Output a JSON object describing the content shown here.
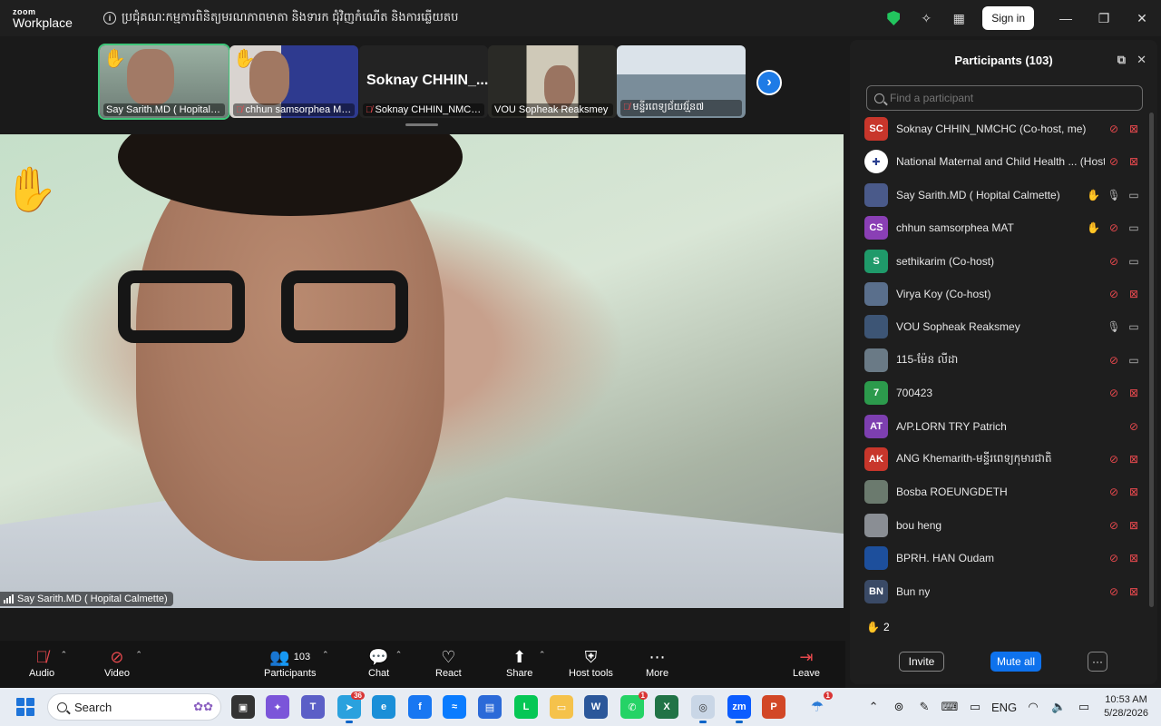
{
  "window": {
    "logo_line1": "zoom",
    "logo_line2": "Workplace",
    "meeting_title": "ប្រជុំគណៈកម្មការពិនិត្យមរណភាពមាតា និងទារក ជុំវិញកំណើត និងការឆ្លើយតប",
    "sign_in": "Sign in"
  },
  "thumbnails": [
    {
      "name": "Say Sarith.MD ( Hopital Cal...",
      "hand": true,
      "muted": false,
      "active": true,
      "bg": "#7e8b86"
    },
    {
      "name": "chhun samsorphea MAT",
      "hand": true,
      "muted": true,
      "active": false,
      "bg": "#3b3f8f"
    },
    {
      "name": "Soknay CHHIN_NMCHC",
      "hand": false,
      "muted": true,
      "active": false,
      "bg": "#2b2b2b",
      "big": "Soknay  CHHIN_..."
    },
    {
      "name": "VOU Sopheak Reaksmey",
      "hand": false,
      "muted": false,
      "active": false,
      "bg": "#3a3a34"
    },
    {
      "name": "មន្ទីរពេទ្យជ័យវរ្ម័ន៧",
      "hand": false,
      "muted": true,
      "active": false,
      "bg": "#5d6c7a"
    }
  ],
  "main": {
    "speaker": "Say Sarith.MD ( Hopital Calmette)"
  },
  "toolbar": {
    "audio": "Audio",
    "video": "Video",
    "participants": "Participants",
    "participants_count": "103",
    "chat": "Chat",
    "react": "React",
    "share": "Share",
    "host_tools": "Host tools",
    "more": "More",
    "leave": "Leave"
  },
  "panel": {
    "title": "Participants (103)",
    "search_placeholder": "Find a participant",
    "raised_hands": "2",
    "invite": "Invite",
    "mute_all": "Mute all",
    "more": "···",
    "participants": [
      {
        "name": "Soknay CHHIN_NMCHC (Co-host, me)",
        "initials": "SC",
        "color": "#c8362b",
        "hand": false,
        "mic": "off",
        "cam": "off"
      },
      {
        "name": "National Maternal and Child Health ... (Host)",
        "initials": "",
        "color": "#ffffff",
        "hand": false,
        "mic": "off",
        "cam": "off"
      },
      {
        "name": "Say Sarith.MD ( Hopital Calmette)",
        "initials": "",
        "color": "#4a5a8a",
        "hand": true,
        "mic": "on",
        "cam": "on"
      },
      {
        "name": "chhun samsorphea MAT",
        "initials": "CS",
        "color": "#8a3fb5",
        "hand": true,
        "mic": "off",
        "cam": "on"
      },
      {
        "name": "sethikarim (Co-host)",
        "initials": "S",
        "color": "#1f9a6a",
        "hand": false,
        "mic": "off",
        "cam": "on"
      },
      {
        "name": "Virya Koy (Co-host)",
        "initials": "",
        "color": "#5a6f8c",
        "hand": false,
        "mic": "off",
        "cam": "off"
      },
      {
        "name": "VOU Sopheak Reaksmey",
        "initials": "",
        "color": "#3d5575",
        "hand": false,
        "mic": "on",
        "cam": "on"
      },
      {
        "name": "115-ម៉ែន លីដា",
        "initials": "",
        "color": "#6a7a86",
        "hand": false,
        "mic": "off",
        "cam": "on"
      },
      {
        "name": "700423",
        "initials": "7",
        "color": "#2c9a4c",
        "hand": false,
        "mic": "off",
        "cam": "off"
      },
      {
        "name": "A/P.LORN TRY Patrich",
        "initials": "AT",
        "color": "#7d3fb0",
        "hand": false,
        "mic": "off",
        "cam": "none"
      },
      {
        "name": "ANG Khemarith-មន្ទីរពេទ្យកុមារជាតិ",
        "initials": "AK",
        "color": "#c8362b",
        "hand": false,
        "mic": "off",
        "cam": "off"
      },
      {
        "name": "Bosba ROEUNGDETH",
        "initials": "",
        "color": "#6b7a6e",
        "hand": false,
        "mic": "off",
        "cam": "off"
      },
      {
        "name": "bou heng",
        "initials": "",
        "color": "#8a8e94",
        "hand": false,
        "mic": "off",
        "cam": "off"
      },
      {
        "name": "BPRH. HAN Oudam",
        "initials": "",
        "color": "#1d4f9c",
        "hand": false,
        "mic": "off",
        "cam": "off"
      },
      {
        "name": "Bun ny",
        "initials": "BN",
        "color": "#3a4a66",
        "hand": false,
        "mic": "off",
        "cam": "off"
      }
    ]
  },
  "taskbar": {
    "search": "Search",
    "lang": "ENG",
    "time": "10:53 AM",
    "date": "5/28/2026",
    "telegram_badge": "36",
    "whatsapp_badge": "1",
    "weather_badge": "1"
  }
}
